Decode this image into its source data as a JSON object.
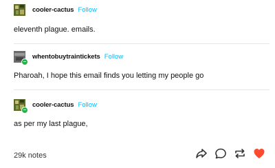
{
  "posts": [
    {
      "username": "cooler-cactus",
      "follow_label": "Follow",
      "text": "eleventh plague. emails."
    },
    {
      "username": "whentobuytraintickets",
      "follow_label": "Follow",
      "text": "Pharoah, I hope this email finds you letting my people go"
    },
    {
      "username": "cooler-cactus",
      "follow_label": "Follow",
      "text": "as per my last plague,"
    }
  ],
  "footer": {
    "notes": "29k notes"
  },
  "actions": [
    "share-icon",
    "reply-icon",
    "reblog-icon",
    "like-icon"
  ],
  "colors": {
    "follow": "#00b8ff",
    "like": "#ff4930",
    "badge": "#23b34a"
  }
}
